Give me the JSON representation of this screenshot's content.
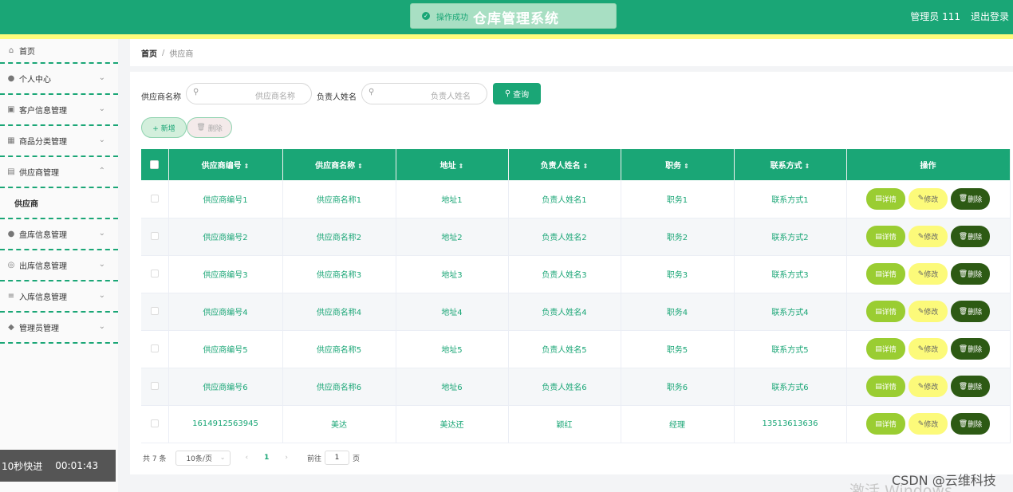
{
  "header": {
    "toast": "操作成功",
    "title": "仓库管理系统",
    "user": "管理员 111",
    "logout": "退出登录"
  },
  "sidebar": {
    "items": [
      {
        "label": "首页",
        "icon": "home-icon"
      },
      {
        "label": "个人中心",
        "icon": "user-icon"
      },
      {
        "label": "客户信息管理",
        "icon": "delete-box-icon"
      },
      {
        "label": "商品分类管理",
        "icon": "grid-icon"
      },
      {
        "label": "供应商管理",
        "icon": "document-icon"
      },
      {
        "label": "供应商",
        "icon": ""
      },
      {
        "label": "盘库信息管理",
        "icon": "user-icon"
      },
      {
        "label": "出库信息管理",
        "icon": "globe-icon"
      },
      {
        "label": "入库信息管理",
        "icon": "list-icon"
      },
      {
        "label": "管理员管理",
        "icon": "pin-icon"
      }
    ]
  },
  "player": {
    "speed": "10秒快进",
    "time": "00:01:43"
  },
  "breadcrumb": {
    "home": "首页",
    "sep": "/",
    "current": "供应商"
  },
  "search": {
    "name_label": "供应商名称",
    "name_placeholder": "供应商名称",
    "person_label": "负责人姓名",
    "person_placeholder": "负责人姓名",
    "query": "查询"
  },
  "actions": {
    "add": "+ 新增",
    "delete": "删除"
  },
  "table": {
    "headers": [
      "供应商编号",
      "供应商名称",
      "地址",
      "负责人姓名",
      "职务",
      "联系方式",
      "操作"
    ],
    "rows": [
      [
        "供应商编号1",
        "供应商名称1",
        "地址1",
        "负责人姓名1",
        "职务1",
        "联系方式1"
      ],
      [
        "供应商编号2",
        "供应商名称2",
        "地址2",
        "负责人姓名2",
        "职务2",
        "联系方式2"
      ],
      [
        "供应商编号3",
        "供应商名称3",
        "地址3",
        "负责人姓名3",
        "职务3",
        "联系方式3"
      ],
      [
        "供应商编号4",
        "供应商名称4",
        "地址4",
        "负责人姓名4",
        "职务4",
        "联系方式4"
      ],
      [
        "供应商编号5",
        "供应商名称5",
        "地址5",
        "负责人姓名5",
        "职务5",
        "联系方式5"
      ],
      [
        "供应商编号6",
        "供应商名称6",
        "地址6",
        "负责人姓名6",
        "职务6",
        "联系方式6"
      ],
      [
        "1614912563945",
        "美达",
        "美达还",
        "颖红",
        "经理",
        "13513613636"
      ]
    ],
    "ops": {
      "detail": "详情",
      "edit": "修改",
      "delete": "删除"
    }
  },
  "pagination": {
    "total": "共 7 条",
    "size": "10条/页",
    "prev": "‹",
    "page": "1",
    "next": "›",
    "goto": "前往",
    "goto_value": "1",
    "page_suffix": "页"
  },
  "watermark": "CSDN @云维科技",
  "activate": "激活 Windows",
  "colors": {
    "primary": "#1aa676",
    "accent_yellow": "#fdfc7c",
    "detail": "#9acd32",
    "edit": "#fcfa7a",
    "danger": "#2d5a14"
  }
}
